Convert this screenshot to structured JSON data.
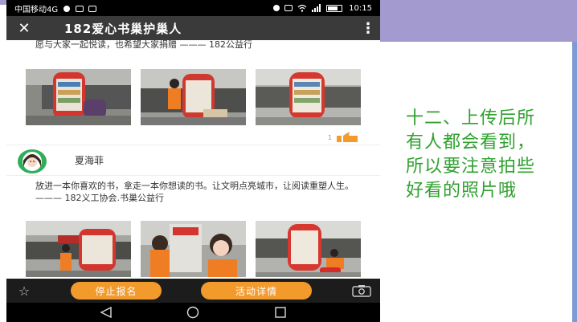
{
  "slide": {
    "caption_lines": [
      "十二、上传后所",
      "有人都会看到，",
      "所以要注意拍些",
      "好看的照片哦"
    ],
    "colors": {
      "band": "#a39bd0",
      "caption": "#2fa12f",
      "edge": "#7f9bd6"
    }
  },
  "status_bar": {
    "carrier": "中国移动4G",
    "time": "10:15",
    "icons": [
      "alarm-icon",
      "hd-icon",
      "wifi-icon",
      "signal-icon",
      "battery-icon"
    ]
  },
  "app_bar": {
    "close_icon": "close-icon",
    "title": "182爱心书巢护巢人",
    "more_icon": "more-vert-icon"
  },
  "posts": [
    {
      "text": "愿与大家一起悦读，也希望大家捐赠 ——— 182公益行",
      "photos": [
        "bookshelf-with-child",
        "child-placing-books",
        "bookshelf-rotunda"
      ],
      "like_count": "1"
    },
    {
      "author": "夏海菲",
      "text": "放进一本你喜欢的书，拿走一本你想读的书。让文明点亮城市，让阅读重塑人生。 ——— 182义工协会.书巢公益行",
      "photos": [
        "volunteer-at-kiosk",
        "volunteers-selfie",
        "volunteer-kneeling"
      ]
    }
  ],
  "bottom_bar": {
    "star_icon": "star-outline-icon",
    "stop_label": "停止报名",
    "detail_label": "活动详情",
    "camera_icon": "camera-icon",
    "accent": "#f39a2c"
  },
  "nav_bar": {
    "icons": [
      "back-triangle-icon",
      "home-circle-icon",
      "recents-square-icon"
    ]
  }
}
